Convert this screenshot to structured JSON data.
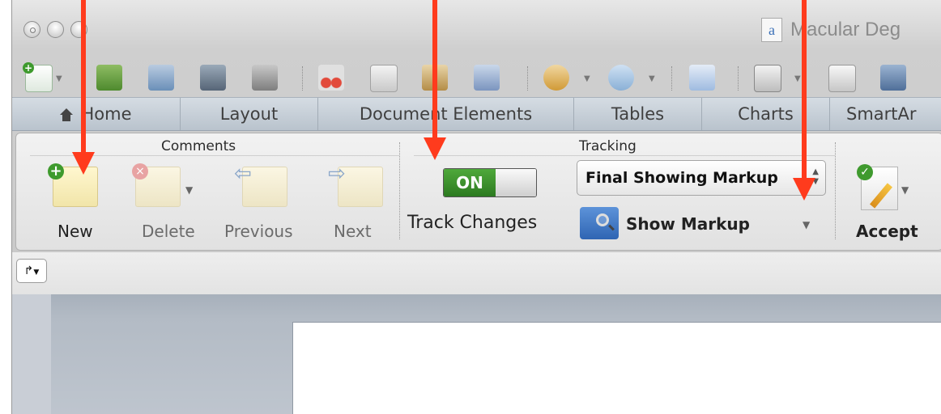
{
  "window": {
    "title": "Macular Deg",
    "doc_icon_letter": "a"
  },
  "tabs": [
    {
      "label": "Home"
    },
    {
      "label": "Layout"
    },
    {
      "label": "Document Elements"
    },
    {
      "label": "Tables"
    },
    {
      "label": "Charts"
    },
    {
      "label": "SmartAr"
    }
  ],
  "ribbon": {
    "comments": {
      "title": "Comments",
      "new": "New",
      "delete": "Delete",
      "previous": "Previous",
      "next": "Next"
    },
    "tracking": {
      "title": "Tracking",
      "toggle_state": "ON",
      "track_changes": "Track Changes",
      "display_mode": "Final Showing Markup",
      "show_markup": "Show Markup"
    },
    "accept": {
      "label": "Accept"
    }
  },
  "ruler": {
    "tab_stop_glyph": "↱"
  },
  "colors": {
    "annotation_arrow": "#ff3b1d",
    "toggle_on": "#3a8f2c"
  }
}
